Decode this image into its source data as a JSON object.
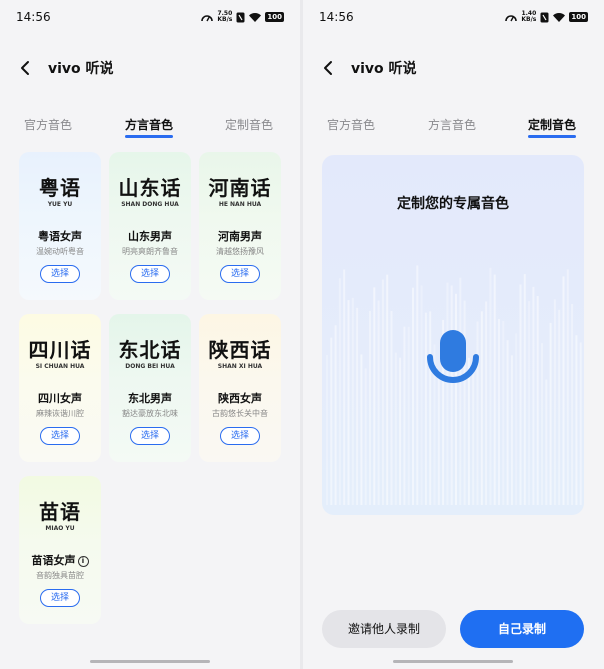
{
  "status": {
    "time": "14:56",
    "left_speed": [
      "7.50",
      "KB/s"
    ],
    "right_speed": [
      "1.40",
      "KB/s"
    ],
    "battery": "100"
  },
  "header": {
    "title": "vivo 听说"
  },
  "tabs": [
    "官方音色",
    "方言音色",
    "定制音色"
  ],
  "select_label": "选择",
  "cards": [
    {
      "big": "粤语",
      "pinyin": "YUE YU",
      "name": "粤语女声",
      "desc": "温婉动听粤音"
    },
    {
      "big": "山东话",
      "pinyin": "SHAN DONG HUA",
      "name": "山东男声",
      "desc": "明亮爽朗齐鲁音"
    },
    {
      "big": "河南话",
      "pinyin": "HE NAN HUA",
      "name": "河南男声",
      "desc": "清越悠扬豫风"
    },
    {
      "big": "四川话",
      "pinyin": "SI CHUAN HUA",
      "name": "四川女声",
      "desc": "麻辣诙谐川腔"
    },
    {
      "big": "东北话",
      "pinyin": "DONG BEI HUA",
      "name": "东北男声",
      "desc": "豁达豪放东北味"
    },
    {
      "big": "陕西话",
      "pinyin": "SHAN XI HUA",
      "name": "陕西女声",
      "desc": "古韵悠长关中音"
    },
    {
      "big": "苗语",
      "pinyin": "MIAO YU",
      "name": "苗语女声",
      "desc": "音韵独具苗腔"
    }
  ],
  "custom": {
    "title": "定制您的专属音色",
    "invite_label": "邀请他人录制",
    "self_label": "自己录制"
  },
  "colors": {
    "accent": "#2a6cf0",
    "primary_button": "#1f6ff2",
    "mic": "#2f7be0"
  }
}
